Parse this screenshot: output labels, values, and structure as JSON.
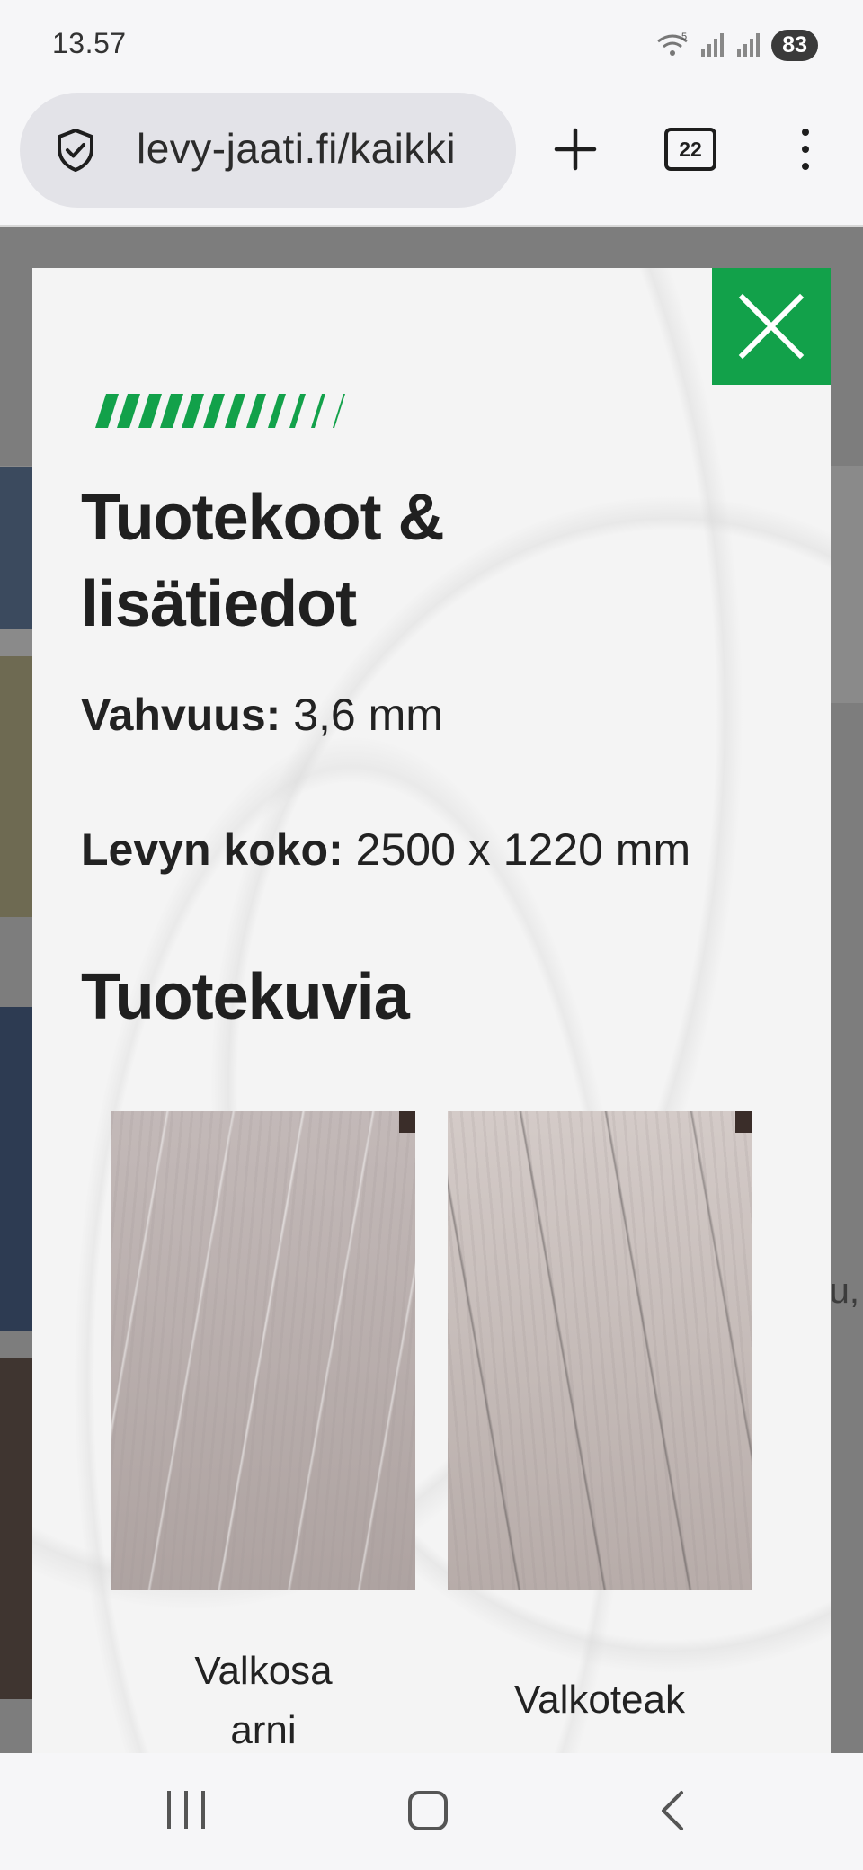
{
  "status_bar": {
    "time": "13.57",
    "battery": "83",
    "wifi_badge": "5"
  },
  "browser": {
    "url": "levy-jaati.fi/kaikki",
    "tab_count": "22",
    "shield_icon": "shield-check-icon",
    "new_tab_icon": "plus-icon",
    "menu_icon": "more-vertical-icon"
  },
  "modal": {
    "title": "Tuotekoot & lisätiedot",
    "specs": [
      {
        "label": "Vahvuus:",
        "value": "3,6 mm"
      },
      {
        "label": "Levyn koko:",
        "value": "2500 x 1220 mm"
      }
    ],
    "images_title": "Tuotekuvia",
    "images": [
      {
        "caption": "Valkosaarni"
      },
      {
        "caption": "Valkoteak"
      }
    ],
    "close_icon": "close-icon",
    "accent_color": "#12a14a"
  },
  "background": {
    "partial_text": "u,"
  },
  "nav_bar": {
    "recent_icon": "recent-apps-icon",
    "home_icon": "home-icon",
    "back_icon": "back-icon"
  }
}
